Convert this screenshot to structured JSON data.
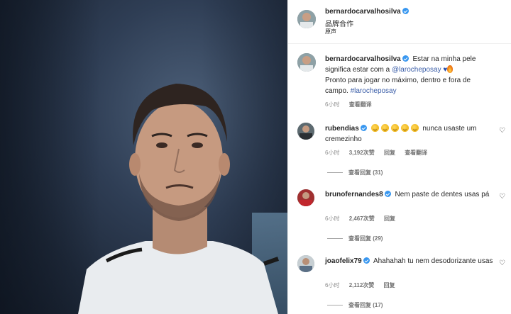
{
  "post": {
    "author": "bernardocarvalhosilva",
    "partnership_label": "品牌合作",
    "audio_label": "原声"
  },
  "caption": {
    "author": "bernardocarvalhosilva",
    "text_1": "Estar na minha pele significa estar com a ",
    "mention": "@larocheposay",
    "text_2": "Pronto para jogar no máximo, dentro e fora de campo. ",
    "hashtag": "#larocheposay",
    "time": "6小时",
    "translate": "查看翻译"
  },
  "comments": [
    {
      "username": "rubendias",
      "text": "nunca usaste um cremezinho",
      "emoji_count": 5,
      "time": "6小时",
      "likes": "3,192次赞",
      "reply": "回复",
      "translate": "查看翻译",
      "view_replies": "查看回复 (31)"
    },
    {
      "username": "brunofernandes8",
      "text": "Nem paste de dentes usas pá",
      "time": "6小时",
      "likes": "2,467次赞",
      "reply": "回复",
      "view_replies": "查看回复 (29)"
    },
    {
      "username": "joaofelix79",
      "text": "Ahahahah tu nem desodorizante usas",
      "time": "6小时",
      "likes": "2,112次赞",
      "reply": "回复",
      "view_replies": "查看回复 (17)"
    }
  ],
  "icons": {
    "verified": "verified-badge-icon",
    "like": "heart-icon"
  },
  "colors": {
    "verified": "#3897f0",
    "link": "#3b5ea8",
    "muted": "#8e8e8e"
  }
}
